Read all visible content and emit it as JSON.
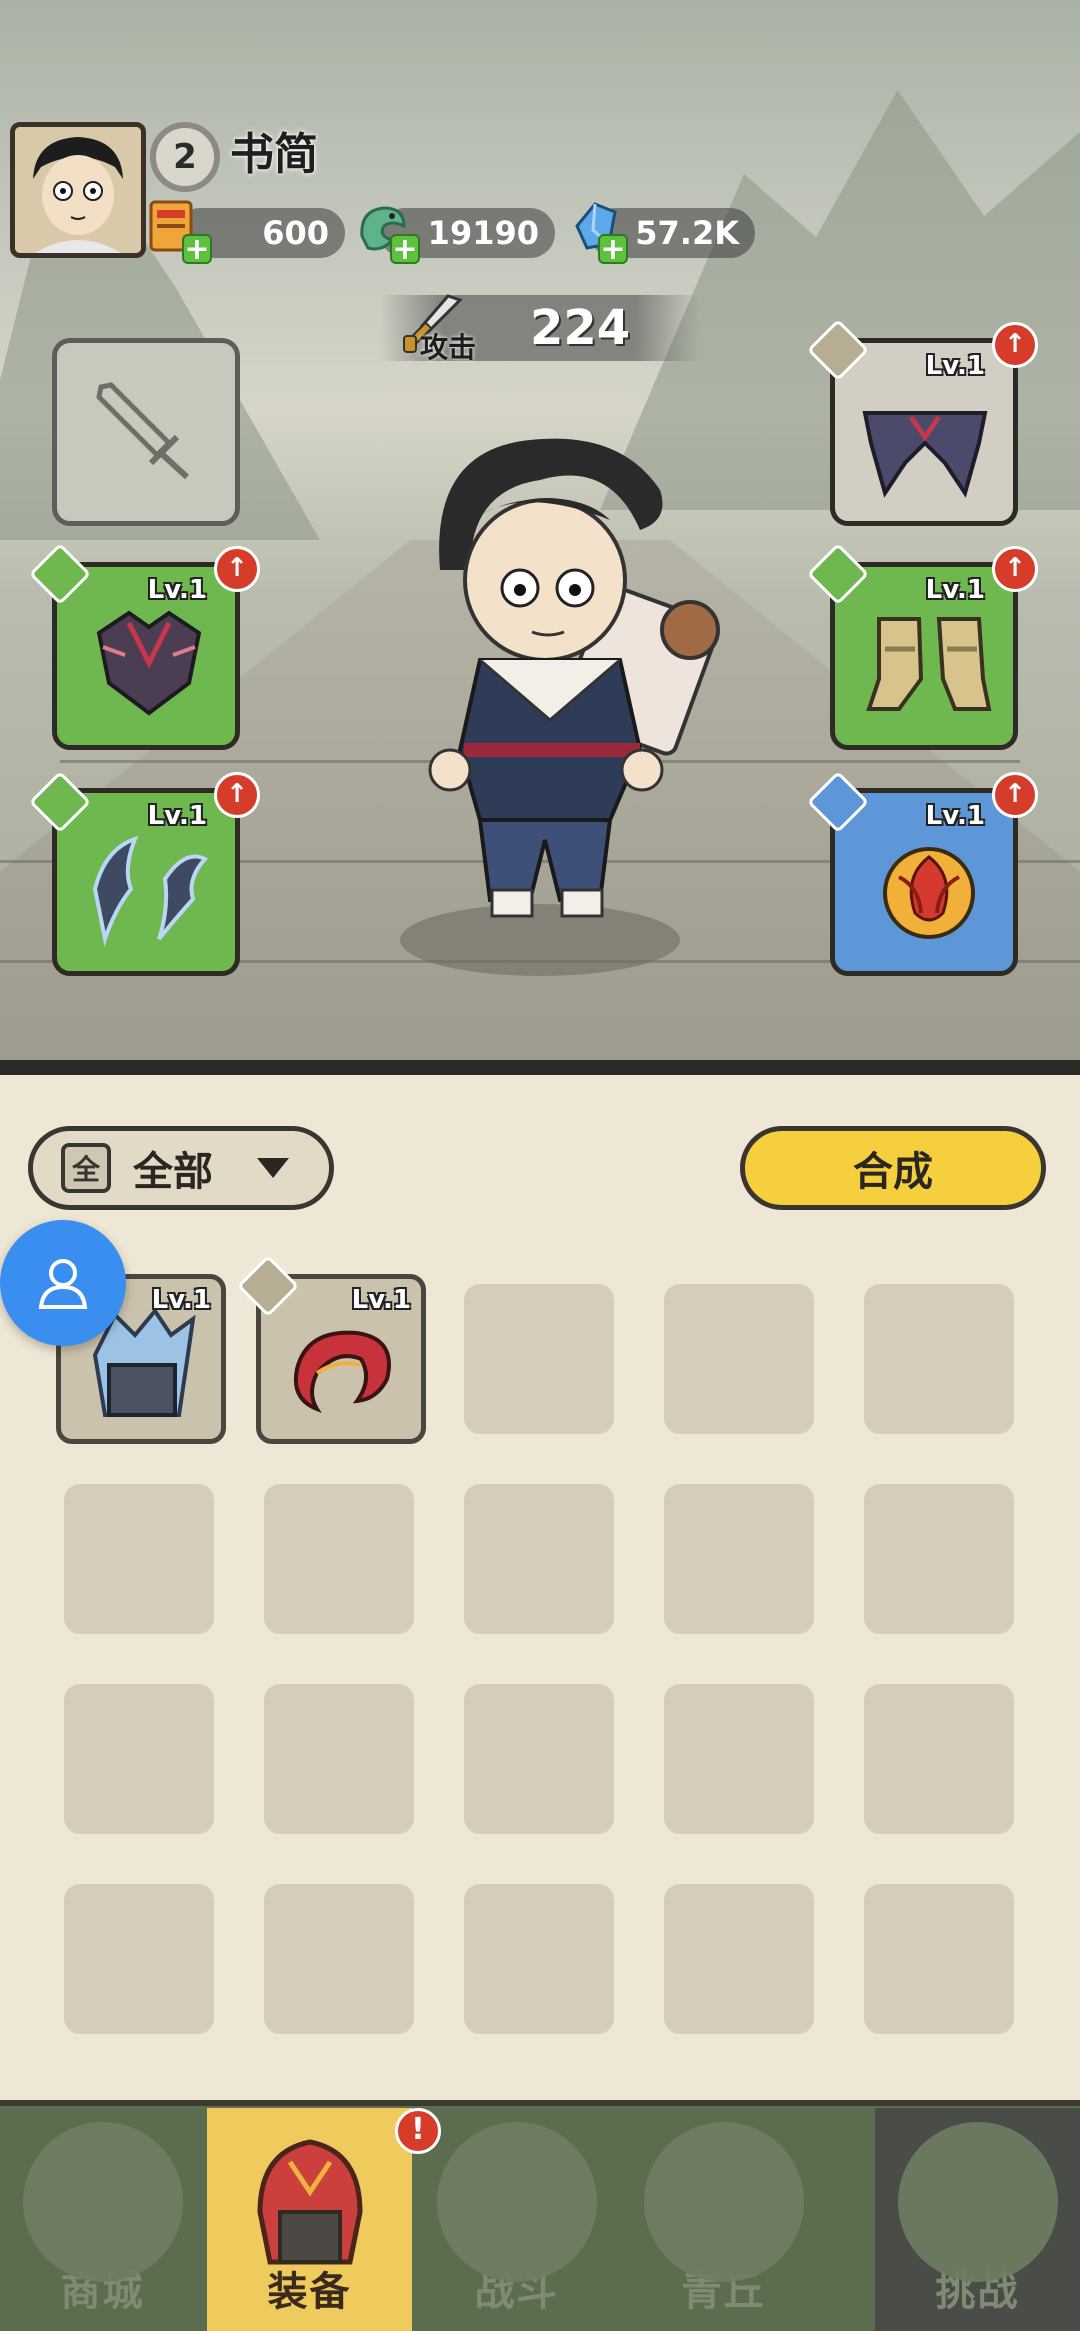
{
  "player": {
    "level": "2",
    "name": "书简"
  },
  "currencies": [
    {
      "icon": "scroll-ticket-icon",
      "value": "600"
    },
    {
      "icon": "jade-dragon-icon",
      "value": "19190"
    },
    {
      "icon": "blue-crystal-icon",
      "value": "57.2K"
    }
  ],
  "attack": {
    "label": "攻击",
    "value": "224"
  },
  "equipment": {
    "weapon": {
      "state": "empty"
    },
    "left_armor": {
      "level": "Lv.1",
      "rarity": "green",
      "upgrade": true
    },
    "left_bracer": {
      "level": "Lv.1",
      "rarity": "green",
      "upgrade": true
    },
    "right_belt": {
      "level": "Lv.1",
      "rarity": "grey",
      "upgrade": true
    },
    "right_boots": {
      "level": "Lv.1",
      "rarity": "green",
      "upgrade": true
    },
    "right_amulet": {
      "level": "Lv.1",
      "rarity": "blue",
      "upgrade": true
    }
  },
  "inventory": {
    "filter_tag": "全",
    "filter_label": "全部",
    "merge_label": "合成",
    "items": [
      {
        "icon": "ice-helmet-icon",
        "level": "Lv.1"
      },
      {
        "icon": "red-bracer-icon",
        "level": "Lv.1"
      }
    ]
  },
  "nav": {
    "tabs": [
      {
        "label": "商城",
        "icon": "shop-pavilion-icon"
      },
      {
        "label": "装备",
        "icon": "red-helmet-icon",
        "active": true,
        "alert": "!"
      },
      {
        "label": "战斗",
        "icon": "crossed-swords-icon"
      },
      {
        "label": "青丘",
        "icon": "mountain-icon"
      },
      {
        "label": "挑战",
        "icon": "gong-icon"
      }
    ]
  },
  "colors": {
    "equip_green": "#6fb74f",
    "equip_blue": "#5d97d8",
    "upgrade_red": "#d63c2a",
    "merge_yellow": "#f6cf3e",
    "nav_active": "#efcb5d"
  }
}
